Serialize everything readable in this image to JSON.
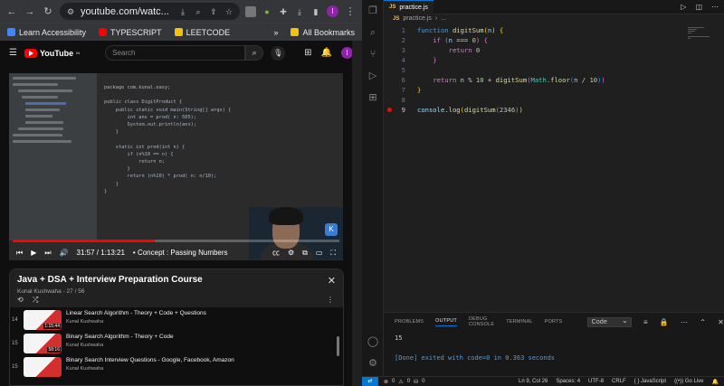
{
  "chrome": {
    "url": "youtube.com/watc...",
    "avatar": "I",
    "bookmarks": [
      {
        "label": "Learn Accessibility",
        "color": "#4285f4"
      },
      {
        "label": "TYPESCRIPT",
        "color": "#ff0000"
      },
      {
        "label": "LEETCODE",
        "color": "#f4c20d"
      }
    ],
    "all_bookmarks": "All Bookmarks"
  },
  "youtube": {
    "logo_text": "YouTube",
    "logo_sup": "IN",
    "search_placeholder": "Search",
    "avatar": "I",
    "video": {
      "time": "31:57 / 1:13:21",
      "chapter": "• Concept : Passing Numbers",
      "progress": 0.435,
      "code_lines": [
        "package com.kunal.easy;",
        "",
        "public class DigitProduct {",
        "    public static void main(String[] args) {",
        "        int ans = prod( n: 505);",
        "        System.out.println(ans);",
        "    }",
        "",
        "    static int prod(int n) {",
        "        if (n%10 == n) {",
        "            return n;",
        "        }",
        "        return (n%10) * prod( n: n/10);",
        "    }",
        "}"
      ]
    },
    "playlist": {
      "title": "Java + DSA + Interview Preparation Course",
      "subtitle": "Kunal Kushwaha - 27 / 56",
      "items": [
        {
          "index": "14",
          "title": "Linear Search Algorithm - Theory + Code + Questions",
          "author": "Kunal Kushwaha",
          "duration": "1:15:44"
        },
        {
          "index": "15",
          "title": "Binary Search Algorithm - Theory + Code",
          "author": "Kunal Kushwaha",
          "duration": "58:16"
        },
        {
          "index": "15",
          "title": "Binary Search Interview Questions - Google, Facebook, Amazon",
          "author": "Kunal Kushwaha",
          "duration": ""
        }
      ]
    }
  },
  "vscode": {
    "tab_label": "practice.js",
    "tab_badge": "JS",
    "breadcrumb_file": "practice.js",
    "breadcrumb_more": "...",
    "editor_lines": [
      {
        "n": "1",
        "text": "function digitSum(n) {"
      },
      {
        "n": "2",
        "text": "    if (n === 0) {"
      },
      {
        "n": "3",
        "text": "        return 0"
      },
      {
        "n": "4",
        "text": "    }"
      },
      {
        "n": "5",
        "text": ""
      },
      {
        "n": "6",
        "text": "    return n % 10 + digitSum(Math.floor(n / 10))"
      },
      {
        "n": "7",
        "text": "}"
      },
      {
        "n": "8",
        "text": ""
      },
      {
        "n": "9",
        "text": "console.log(digitSum(2346))"
      }
    ],
    "panel_tabs": [
      "PROBLEMS",
      "OUTPUT",
      "DEBUG CONSOLE",
      "TERMINAL",
      "PORTS"
    ],
    "panel_active": "OUTPUT",
    "output_channel": "Code",
    "output_lines": [
      "15",
      "[Done] exited with code=0 in 0.363 seconds"
    ],
    "status": {
      "errors": "0",
      "warnings": "0",
      "ports": "0",
      "position": "Ln 9, Col 26",
      "spaces": "Spaces: 4",
      "encoding": "UTF-8",
      "eol": "CRLF",
      "language": "JavaScript",
      "golive": "Go Live"
    }
  }
}
